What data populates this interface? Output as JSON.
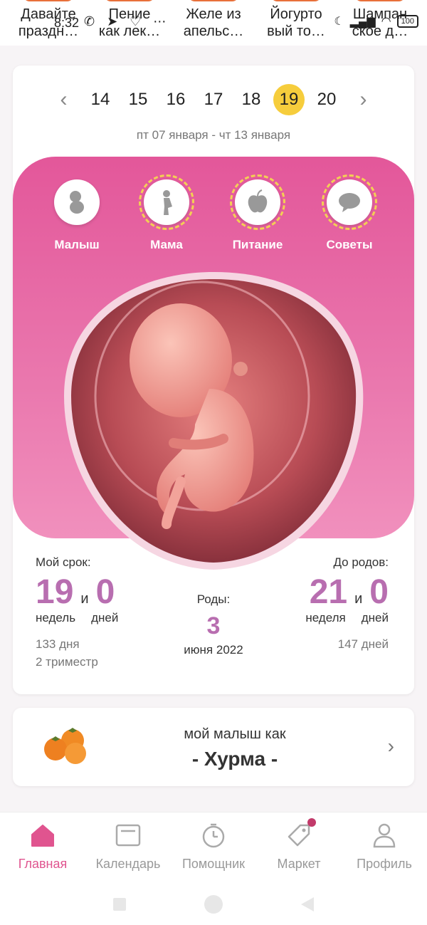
{
  "stories": [
    {
      "title": "Давайте\nпраздн…"
    },
    {
      "title": "Пение\nкак лек…"
    },
    {
      "title": "Желе из\nапельс…"
    },
    {
      "title": "Йогурто\nвый то…"
    },
    {
      "title": "Шампан\nское д…"
    }
  ],
  "status_bar": {
    "time": "8:32",
    "battery": "100"
  },
  "weeks": {
    "items": [
      "14",
      "15",
      "16",
      "17",
      "18",
      "19",
      "20"
    ],
    "active": "19",
    "range": "пт 07 января - чт 13 января"
  },
  "tabs": [
    {
      "label": "Малыш",
      "icon": "baby-icon"
    },
    {
      "label": "Мама",
      "icon": "pregnant-woman-icon"
    },
    {
      "label": "Питание",
      "icon": "apple-icon"
    },
    {
      "label": "Советы",
      "icon": "chat-bubble-icon"
    }
  ],
  "term": {
    "title": "Мой срок:",
    "weeks": "19",
    "and": "и",
    "days": "0",
    "weeks_unit": "недель",
    "days_unit": "дней",
    "total_days": "133 дня",
    "trimester": "2 триместр"
  },
  "birth": {
    "title": "Роды:",
    "day": "3",
    "month_year": "июня 2022"
  },
  "remaining": {
    "title": "До родов:",
    "weeks": "21",
    "and": "и",
    "days": "0",
    "weeks_unit": "неделя",
    "days_unit": "дней",
    "total_days": "147 дней"
  },
  "fruit": {
    "caption": "мой малыш как",
    "name": "- Хурма -"
  },
  "nav": [
    {
      "label": "Главная",
      "icon": "home-icon",
      "active": true
    },
    {
      "label": "Календарь",
      "icon": "calendar-icon"
    },
    {
      "label": "Помощник",
      "icon": "timer-icon"
    },
    {
      "label": "Маркет",
      "icon": "tag-icon"
    },
    {
      "label": "Профиль",
      "icon": "profile-icon"
    }
  ],
  "colors": {
    "accent": "#e0548f",
    "pink_panel": "#e3579a",
    "number": "#b86eb0",
    "highlight": "#f6cd3c"
  }
}
